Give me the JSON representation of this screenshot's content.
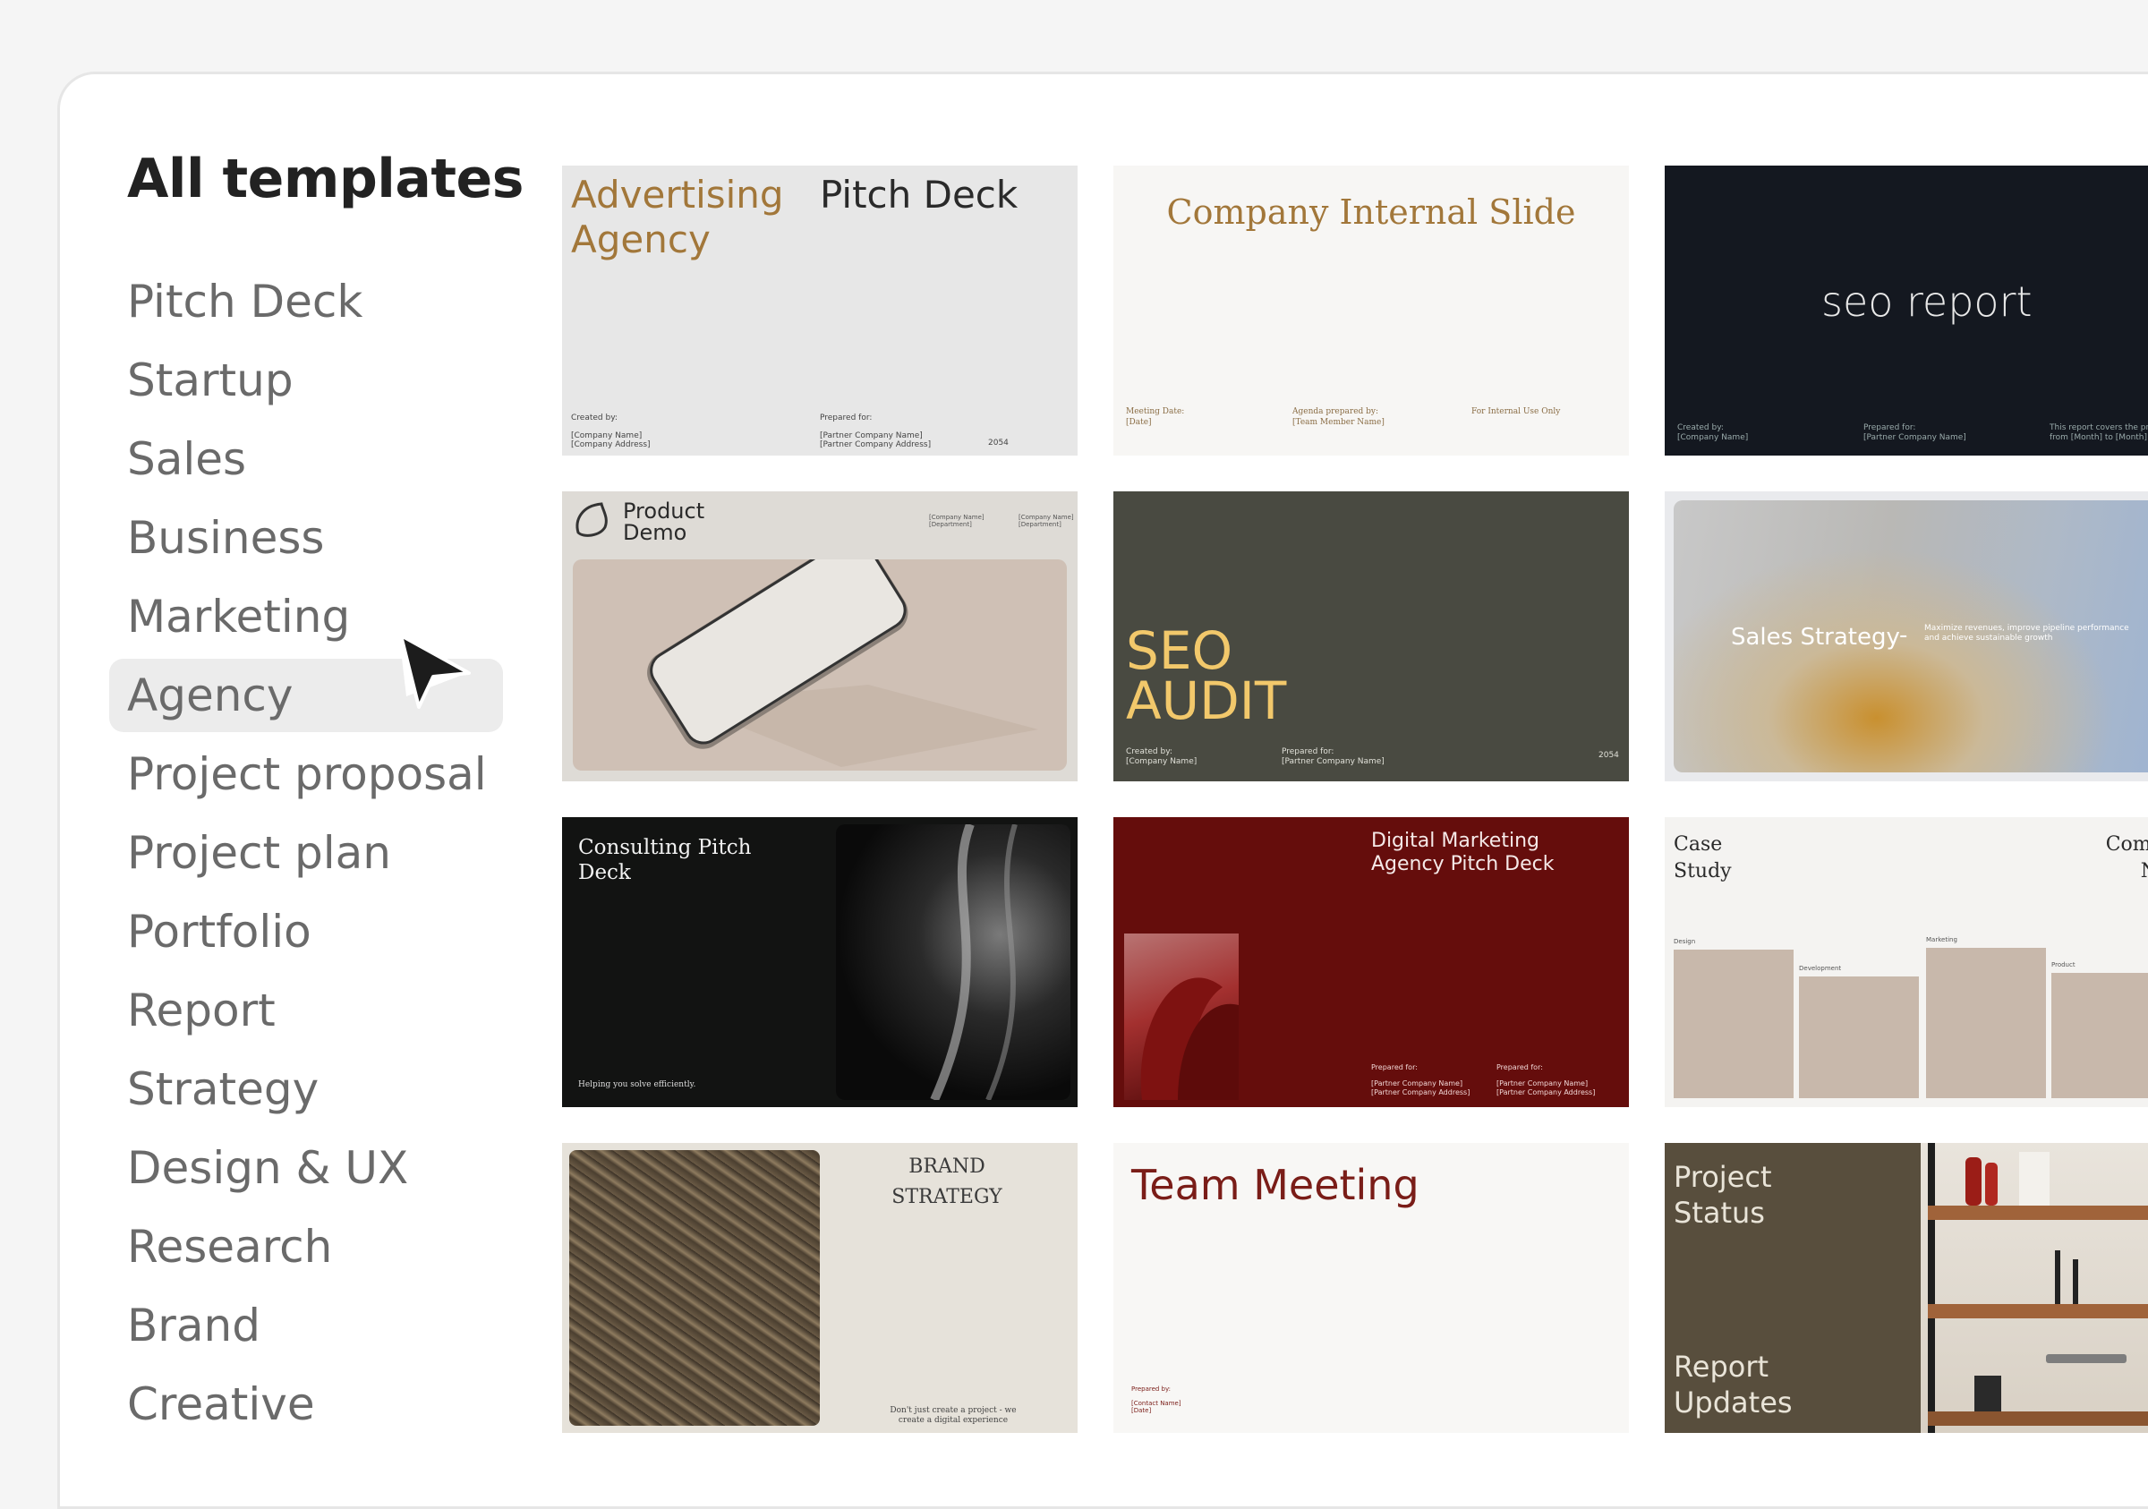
{
  "sidebar": {
    "heading": "All templates",
    "items": [
      {
        "label": "Pitch Deck"
      },
      {
        "label": "Startup"
      },
      {
        "label": "Sales"
      },
      {
        "label": "Business"
      },
      {
        "label": "Marketing"
      },
      {
        "label": "Agency",
        "selected": true
      },
      {
        "label": "Project proposal"
      },
      {
        "label": "Project plan"
      },
      {
        "label": "Portfolio"
      },
      {
        "label": "Report"
      },
      {
        "label": "Strategy"
      },
      {
        "label": "Design & UX"
      },
      {
        "label": "Research"
      },
      {
        "label": "Brand"
      },
      {
        "label": "Creative"
      }
    ]
  },
  "cursor_icon": "arrow-cursor-icon",
  "templates": {
    "advertising": {
      "title": "Advertising Agency",
      "subtitle": "Pitch Deck",
      "created_by": "Created by:",
      "company_name": "[Company Name]",
      "company_address": "[Company Address]",
      "prepared_for": "Prepared for:",
      "partner_name": "[Partner Company Name]",
      "partner_address": "[Partner Company Address]",
      "year": "2054",
      "accent": "#a2773a"
    },
    "internal": {
      "title": "Company Internal Slide",
      "meeting_date": "Meeting Date:",
      "date": "[Date]",
      "agenda": "Agenda prepared by:",
      "team_member": "[Team Member Name]",
      "internal_use": "For Internal Use Only",
      "accent": "#a2773a"
    },
    "seo_report": {
      "title": "seo report",
      "created_by": "Created by:",
      "company_name": "[Company Name]",
      "prepared_for": "Prepared for:",
      "partner_name": "[Partner Company Name]",
      "note": "This report covers the progress ma",
      "note2": "from [Month] to [Month] [Year]."
    },
    "product_demo": {
      "title": "Product Demo",
      "company1": "[Company Name]",
      "department1": "[Department]",
      "company2": "[Company Name]",
      "department2": "[Department]"
    },
    "seo_audit": {
      "title": "SEO AUDIT",
      "created_by": "Created by:",
      "company_name": "[Company Name]",
      "prepared_for": "Prepared for:",
      "partner_name": "[Partner Company Name]",
      "year": "2054",
      "accent": "#f2c86b"
    },
    "sales_strategy": {
      "title": "Sales Strategy",
      "dash": "-",
      "tagline": "Maximize revenues, improve pipeline performance and achieve sustainable growth"
    },
    "consulting": {
      "title": "Consulting Pitch Deck",
      "tagline": "Helping you solve efficiently."
    },
    "digital_marketing": {
      "title": "Digital Marketing Agency Pitch Deck",
      "prepared_for1": "Prepared for:",
      "partner1": "[Partner Company Name]",
      "partner_addr1": "[Partner Company Address]",
      "prepared_for2": "Prepared for:",
      "partner2": "[Partner Company Name]",
      "partner_addr2": "[Partner Company Address]"
    },
    "case_study": {
      "title": "Case Study",
      "company_label": "Compan Nam",
      "columns": [
        "Design",
        "Development",
        "Marketing",
        "Product"
      ]
    },
    "brand_strategy": {
      "title": "BRAND STRATEGY",
      "tagline": "Don't just create a project - we create a digital experience"
    },
    "team_meeting": {
      "title": "Team Meeting",
      "prepared_by": "Prepared by:",
      "contact": "[Contact Name]",
      "date": "[Date]",
      "accent": "#7a1d18"
    },
    "project_status": {
      "title": "Project Status",
      "subtitle": "Report Updates"
    }
  }
}
